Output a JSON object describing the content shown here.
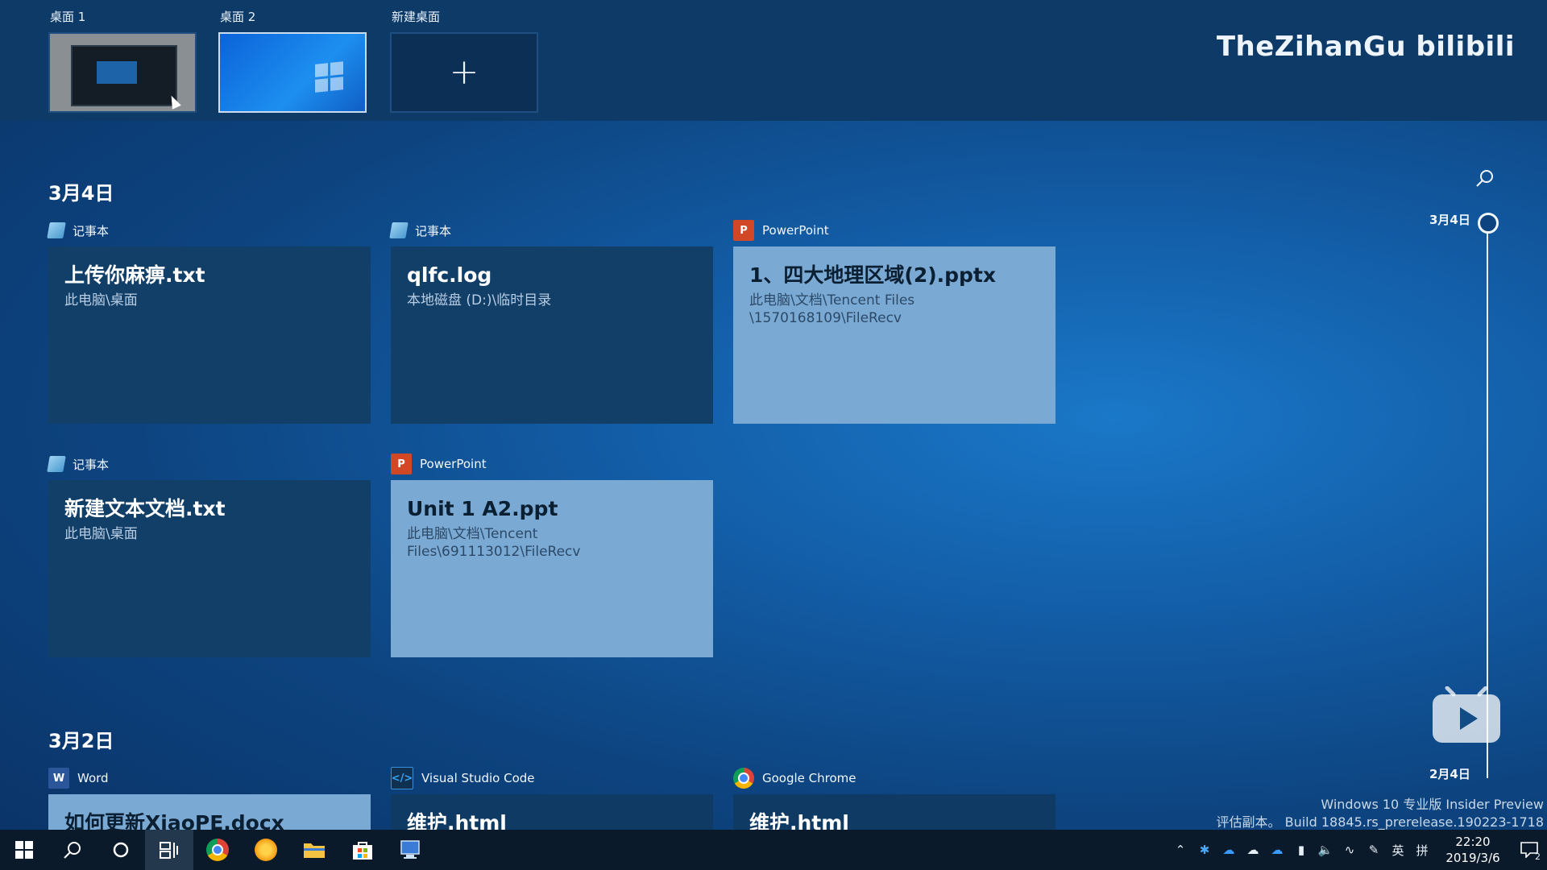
{
  "desktops": {
    "items": [
      {
        "label": "桌面 1"
      },
      {
        "label": "桌面 2"
      },
      {
        "label": "新建桌面",
        "symbol": "+"
      }
    ]
  },
  "brand": {
    "text": "TheZihanGu bilibili"
  },
  "timeline": {
    "sections": [
      {
        "date": "3月4日",
        "cards": [
          {
            "app": "记事本",
            "app_icon": "notepad-icon",
            "title": "上传你麻痹.txt",
            "path": "此电脑\\桌面"
          },
          {
            "app": "记事本",
            "app_icon": "notepad-icon",
            "title": "qlfc.log",
            "path": "本地磁盘 (D:)\\临时目录"
          },
          {
            "app": "PowerPoint",
            "app_icon": "powerpoint-icon",
            "title": "1、四大地理区域(2).pptx",
            "path": "此电脑\\文档\\Tencent Files",
            "path2": "\\1570168109\\FileRecv"
          },
          {
            "app": "记事本",
            "app_icon": "notepad-icon",
            "title": "新建文本文档.txt",
            "path": "此电脑\\桌面"
          },
          {
            "app": "PowerPoint",
            "app_icon": "powerpoint-icon",
            "title": "Unit 1 A2.ppt",
            "path": "此电脑\\文档\\Tencent Files\\691113012\\FileRecv"
          }
        ]
      },
      {
        "date": "3月2日",
        "cards": [
          {
            "app": "Word",
            "app_icon": "word-icon",
            "title": "如何更新XiaoPE.docx"
          },
          {
            "app": "Visual Studio Code",
            "app_icon": "vscode-icon",
            "title": "维护.html"
          },
          {
            "app": "Google Chrome",
            "app_icon": "chrome-icon",
            "title": "维护.html"
          }
        ]
      }
    ]
  },
  "scrubber": {
    "top_date": "3月4日",
    "bottom_date": "2月4日"
  },
  "watermark": {
    "line1": "Windows 10 专业版 Insider Preview",
    "line2": "评估副本。 Build 18845.rs_prerelease.190223-1718"
  },
  "taskbar": {
    "tray_lang": "英",
    "tray_ime": "拼",
    "time": "22:20",
    "date": "2019/3/6",
    "notifications": "2"
  }
}
